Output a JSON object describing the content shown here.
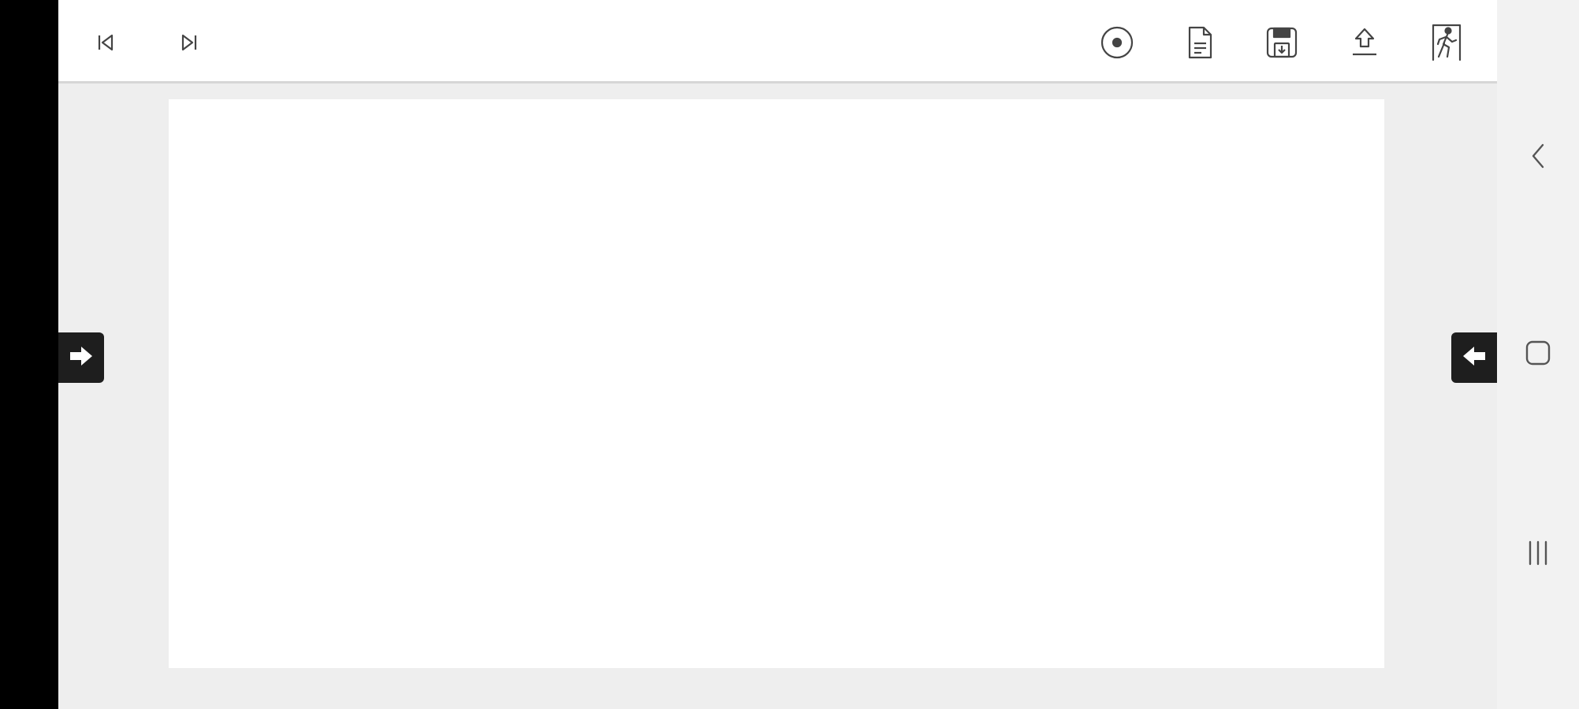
{
  "toolbar": {
    "left_buttons": [
      {
        "icon": "skip-previous-icon"
      },
      {
        "icon": "skip-next-icon"
      }
    ],
    "right_buttons": [
      {
        "icon": "record-icon"
      },
      {
        "icon": "document-icon"
      },
      {
        "icon": "save-icon"
      },
      {
        "icon": "upload-icon"
      },
      {
        "icon": "exit-icon"
      }
    ]
  },
  "edge_tabs": {
    "left": {
      "icon": "arrow-right-icon"
    },
    "right": {
      "icon": "arrow-left-icon"
    }
  },
  "system_nav": {
    "buttons": [
      {
        "icon": "back-icon"
      },
      {
        "icon": "home-icon"
      },
      {
        "icon": "recents-icon"
      }
    ]
  },
  "colors": {
    "toolbar_bg": "#ffffff",
    "canvas_bg": "#eeeeee",
    "page_bg": "#ffffff",
    "tab_bg": "#1e1e1e",
    "icon": "#444444"
  }
}
